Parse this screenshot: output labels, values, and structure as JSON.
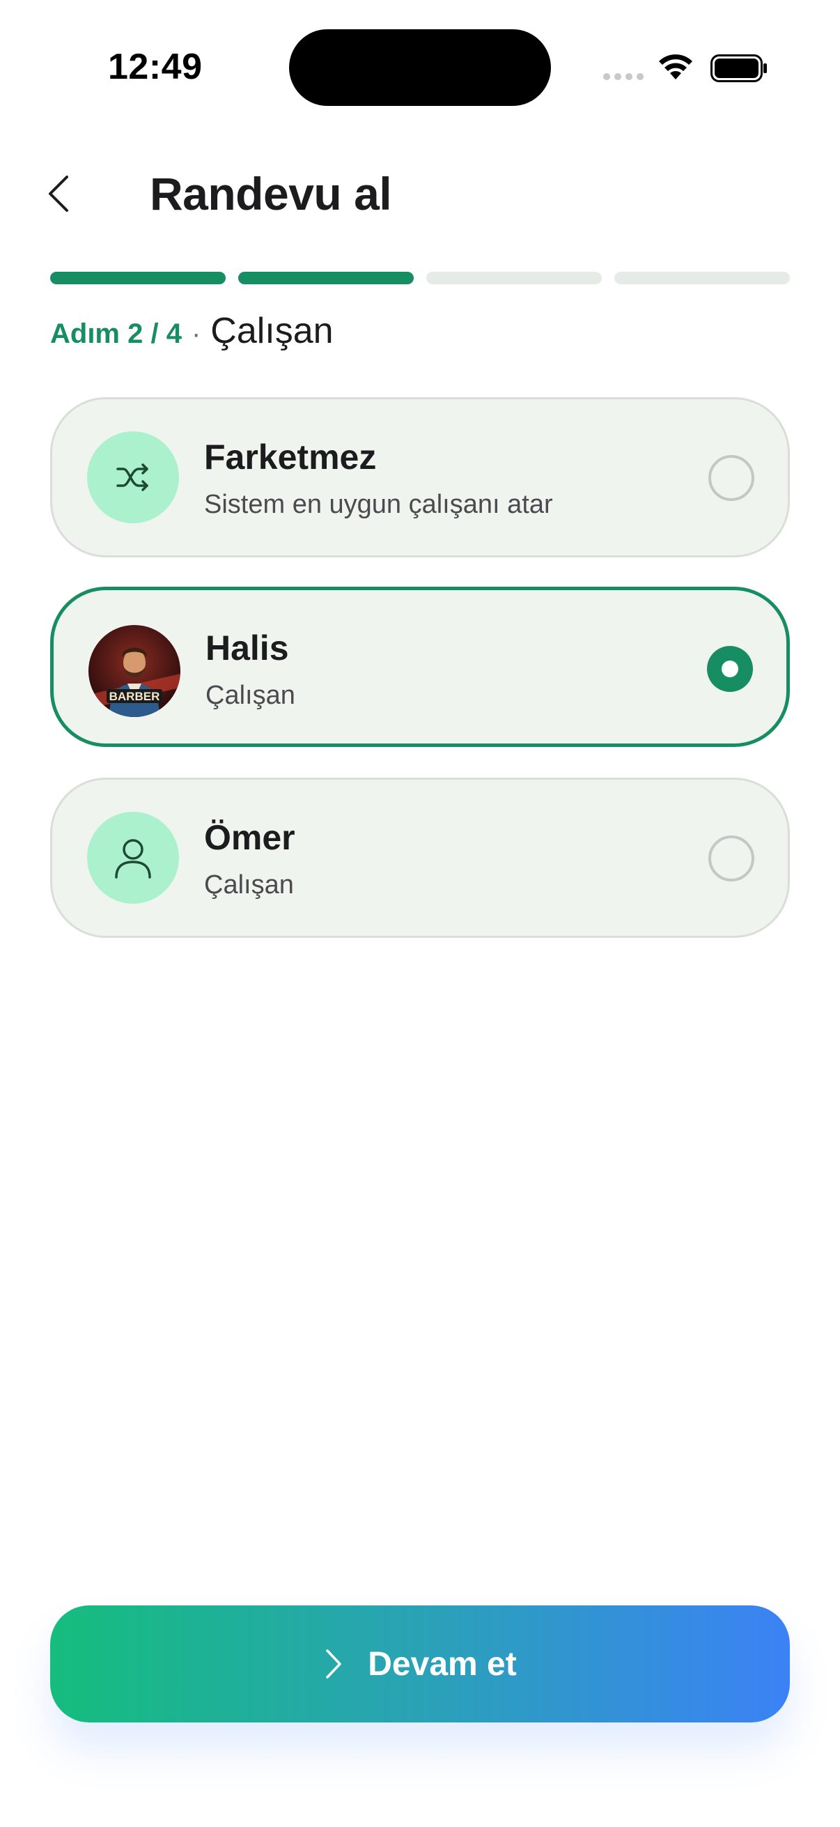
{
  "status_bar": {
    "time": "12:49",
    "icons": [
      "cellular-signal-icon",
      "wifi-icon",
      "battery-icon"
    ]
  },
  "header": {
    "back_icon": "chevron-left-icon",
    "title": "Randevu al"
  },
  "progress": {
    "total_steps": 4,
    "completed_steps": 2
  },
  "step": {
    "count_label": "Adım 2 / 4",
    "separator": "·",
    "name": "Çalışan"
  },
  "employees": [
    {
      "name": "Farketmez",
      "subtitle": "Sistem en uygun çalışanı atar",
      "icon": "shuffle-icon",
      "selected": false
    },
    {
      "name": "Halis",
      "subtitle": "Çalışan",
      "icon": "barber-avatar",
      "avatar_text": "BARBER",
      "selected": true
    },
    {
      "name": "Ömer",
      "subtitle": "Çalışan",
      "icon": "user-icon",
      "selected": false
    }
  ],
  "cta": {
    "label": "Devam et",
    "icon": "chevron-right-icon"
  },
  "colors": {
    "accent": "#168d62",
    "card_bg": "#eff4ef",
    "avatar_bg": "#abf1cd",
    "cta_gradient_start": "#15bd7d",
    "cta_gradient_end": "#3b82f6"
  }
}
